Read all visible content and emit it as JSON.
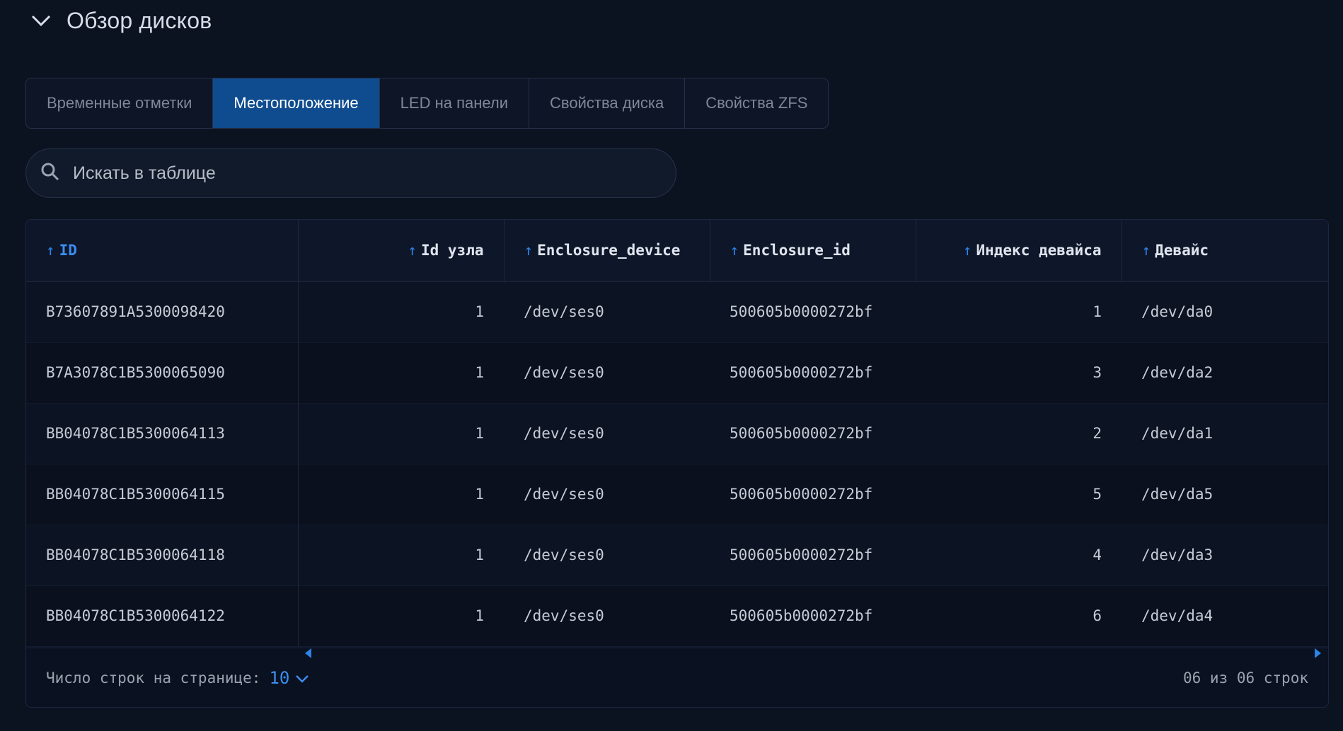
{
  "section": {
    "title": "Обзор дисков",
    "icon": "chevron-down-icon"
  },
  "tabs": [
    {
      "label": "Временные отметки",
      "active": false
    },
    {
      "label": "Местоположение",
      "active": true
    },
    {
      "label": "LED на панели",
      "active": false
    },
    {
      "label": "Свойства диска",
      "active": false
    },
    {
      "label": "Свойства ZFS",
      "active": false
    }
  ],
  "search": {
    "placeholder": "Искать в таблице",
    "icon": "search-icon"
  },
  "table": {
    "columns": [
      {
        "label": "ID",
        "sort": "asc",
        "active": true
      },
      {
        "label": "Id узла",
        "sort": "asc"
      },
      {
        "label": "Enclosure_device",
        "sort": "asc"
      },
      {
        "label": "Enclosure_id",
        "sort": "asc"
      },
      {
        "label": "Индекс девайса",
        "sort": "asc"
      },
      {
        "label": "Девайс",
        "sort": "asc"
      }
    ],
    "rows": [
      [
        "B73607891A5300098420",
        "1",
        "/dev/ses0",
        "500605b0000272bf",
        "1",
        "/dev/da0"
      ],
      [
        "B7A3078C1B5300065090",
        "1",
        "/dev/ses0",
        "500605b0000272bf",
        "3",
        "/dev/da2"
      ],
      [
        "BB04078C1B5300064113",
        "1",
        "/dev/ses0",
        "500605b0000272bf",
        "2",
        "/dev/da1"
      ],
      [
        "BB04078C1B5300064115",
        "1",
        "/dev/ses0",
        "500605b0000272bf",
        "5",
        "/dev/da5"
      ],
      [
        "BB04078C1B5300064118",
        "1",
        "/dev/ses0",
        "500605b0000272bf",
        "4",
        "/dev/da3"
      ],
      [
        "BB04078C1B5300064122",
        "1",
        "/dev/ses0",
        "500605b0000272bf",
        "6",
        "/dev/da4"
      ]
    ]
  },
  "footer": {
    "rows_per_page_label": "Число строк на странице:",
    "rows_per_page_value": "10",
    "summary": "06 из 06 строк"
  },
  "colors": {
    "accent": "#2e83e6",
    "active_tab": "#0f4c8f",
    "background": "#0b1220"
  }
}
